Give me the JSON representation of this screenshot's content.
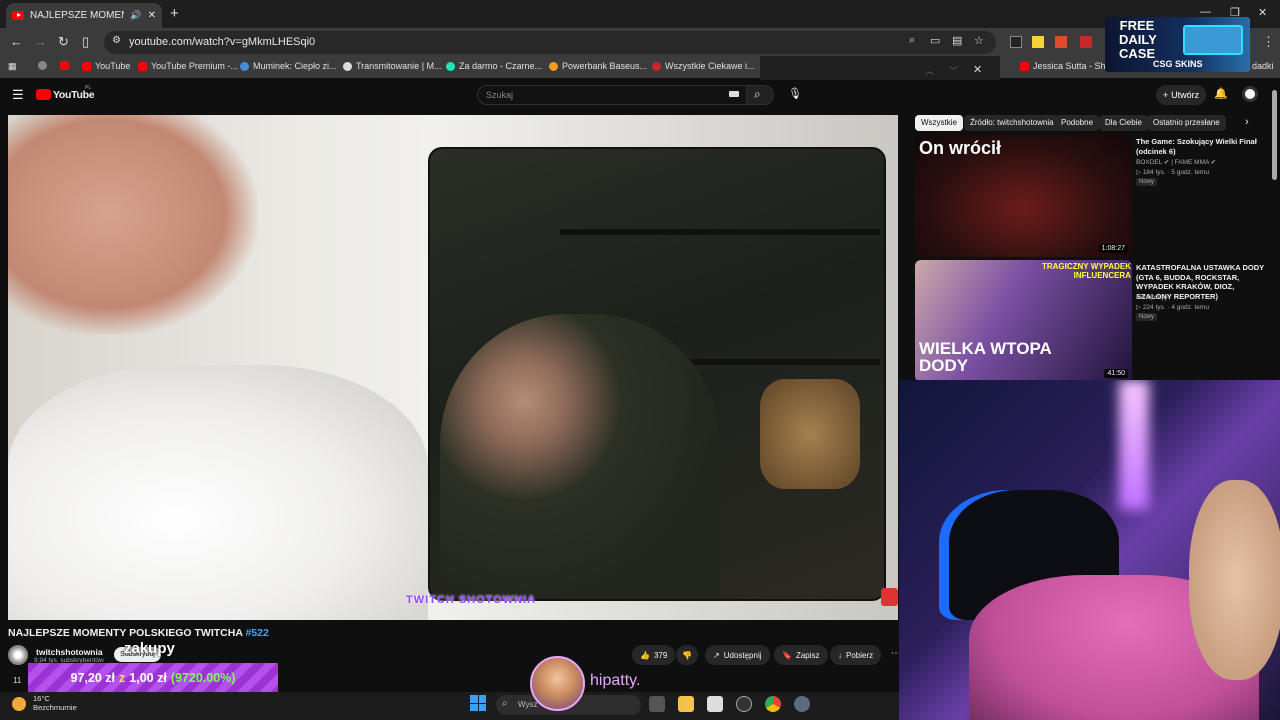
{
  "browser": {
    "tab_title": "NAJLEPSZE MOMENTY PO",
    "new_tab": "+",
    "url": "youtube.com/watch?v=gMkmLHESqi0",
    "bookmarks": [
      {
        "label": "YouTube"
      },
      {
        "label": "YouTube Premium -..."
      },
      {
        "label": "Muminek: Ciepło zi..."
      },
      {
        "label": "Transmitowanie | M..."
      },
      {
        "label": "Za darmo - Czarne..."
      },
      {
        "label": "Powerbank Baseus..."
      },
      {
        "label": "Wszystkie Ciekawe i..."
      },
      {
        "label": "Jessica Sutta - Show"
      },
      {
        "label": "dadki"
      }
    ]
  },
  "ad": {
    "headline": "FREE DAILY CASE",
    "brand": "CSG SKINS"
  },
  "youtube": {
    "logo": "YouTube",
    "logo_region": "PL",
    "search_placeholder": "Szukaj",
    "create_label": "Utwórz"
  },
  "video": {
    "overlay_logo": "TWITCH SHOTOWNIA",
    "title": "NAJLEPSZE MOMENTY POLSKIEGO TWITCHA",
    "tag": "#522",
    "channel": "twitchshotownia",
    "subscribers": "9,94 tys. subskrybentów",
    "subscribe_label": "Subskrybuj",
    "caption": "zakupy",
    "likes": "379",
    "share_label": "Udostępnij",
    "save_label": "Zapisz",
    "download_label": "Pobierz"
  },
  "donation": {
    "amount": "97,20 zł",
    "sep": "z",
    "goal": "1,00 zł",
    "percent": "(9720.00%)"
  },
  "sidebar": {
    "chips": [
      "Wszystkie",
      "Źródło: twitchshotownia",
      "Podobne",
      "Dla Ciebie",
      "Ostatnio przesłane"
    ],
    "videos": [
      {
        "thumb_text": "On wrócił",
        "duration": "1:08:27",
        "title": "The Game: Szokujący Wielki Finał (odcinek 6)",
        "channel": "BOXDEL ✔ | FAME MMA ✔",
        "views": "184 tys.",
        "age": "5 godz. temu",
        "badge": "Nowy"
      },
      {
        "thumb_text": "WIELKA WTOPA DODY",
        "thumb_top": "TRAGICZNY WYPADEK INFLUENCERA",
        "duration": "41:50",
        "title": "KATASTROFALNA USTAWKA DODY (GTA 6, BUDDA, ROCKSTAR, WYPADEK KRAKÓW, DIOZ, SZALONY REPORTER)",
        "channel": "Konopskyy",
        "views": "224 tys.",
        "age": "4 godz. temu",
        "badge": "Nowy"
      }
    ]
  },
  "taskbar": {
    "temp": "16°C",
    "weather": "Bezchmurnie",
    "search": "Wysz",
    "clock_frag": "11"
  },
  "stream_overlay": {
    "username": "hipatty."
  }
}
